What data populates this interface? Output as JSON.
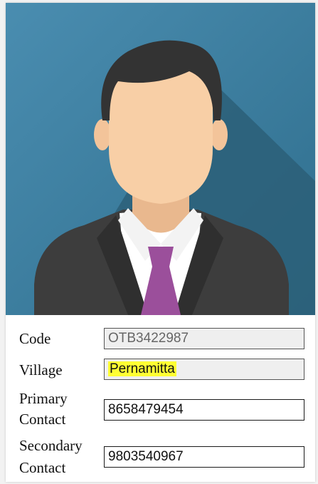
{
  "profile": {
    "photo_icon": "person-avatar-icon",
    "colors": {
      "background": "#3f7fa0",
      "shadow": "#2b5f78",
      "suit": "#3d3d3d",
      "tie": "#9b4f9b",
      "skin": "#f8cfa6",
      "hair": "#333333"
    }
  },
  "fields": {
    "code": {
      "label": "Code",
      "value": "OTB3422987"
    },
    "village": {
      "label": "Village",
      "value": "Pernamitta",
      "highlight": "#ffff33"
    },
    "primary": {
      "label_line1": "Primary",
      "label_line2": "Contact",
      "value": "8658479454"
    },
    "secondary": {
      "label_line1": "Secondary",
      "label_line2": "Contact",
      "value": "9803540967"
    }
  }
}
